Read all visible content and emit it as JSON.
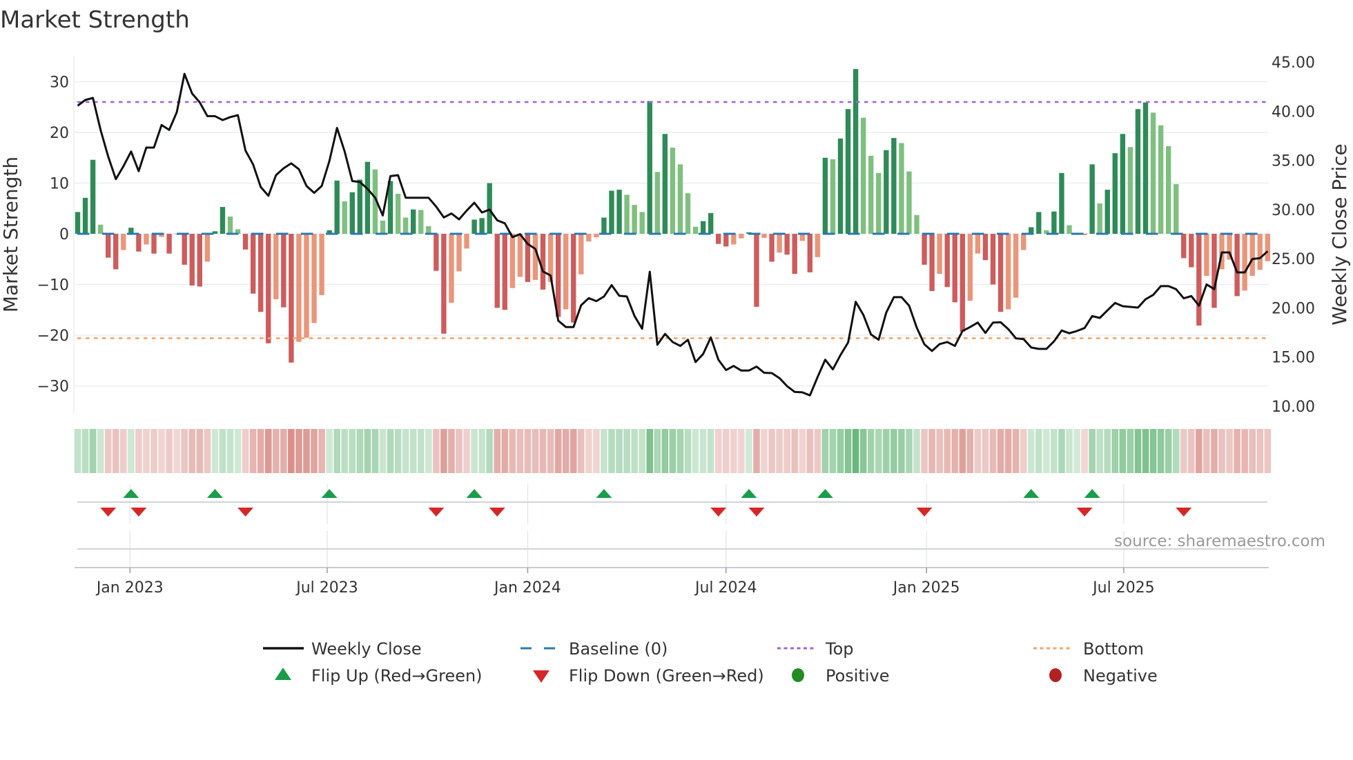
{
  "title": "Market Strength",
  "source": "source: sharemaestro.com",
  "colors": {
    "bar_up_strong": "#2e8b57",
    "bar_up_weak": "#7fbf7f",
    "bar_down_strong": "#cd5c5c",
    "bar_down_weak": "#e9967a",
    "close": "#111111",
    "baseline": "#2a78b0",
    "top": "#a066d8",
    "bottom": "#f2a56a",
    "flip_up": "#1a9e4a",
    "flip_down": "#d62728",
    "positive": "#228b22",
    "negative": "#b22222"
  },
  "legend": {
    "close": "Weekly Close",
    "baseline": "Baseline (0)",
    "top": "Top",
    "bottom": "Bottom",
    "flip_up": "Flip Up (Red→Green)",
    "flip_down": "Flip Down (Green→Red)",
    "positive": "Positive",
    "negative": "Negative"
  },
  "chart_data": {
    "type": "bar",
    "title": "Market Strength",
    "ylabel": "Market Strength",
    "y2label": "Weekly Close Price",
    "ylim": [
      -35.5,
      35.1
    ],
    "y2lim": [
      9.23,
      45.63
    ],
    "yticks": [
      30,
      20,
      10,
      0,
      -10,
      -20,
      -30
    ],
    "ytick_labels": [
      "30",
      "20",
      "10",
      "0",
      "−10",
      "−20",
      "−30"
    ],
    "y2ticks": [
      45,
      40,
      35,
      30,
      25,
      20,
      15,
      10
    ],
    "y2tick_labels": [
      "45.00",
      "40.00",
      "35.00",
      "30.00",
      "25.00",
      "20.00",
      "15.00",
      "10.00"
    ],
    "grid": true,
    "first_week": "2022-11-14",
    "frequency": "weekly",
    "xticks": [
      {
        "label": "Jan 2023",
        "date": "2023-01-01"
      },
      {
        "label": "Jul 2023",
        "date": "2023-07-01"
      },
      {
        "label": "Jan 2024",
        "date": "2024-01-01"
      },
      {
        "label": "Jul 2024",
        "date": "2024-07-01"
      },
      {
        "label": "Jan 2025",
        "date": "2025-01-01"
      },
      {
        "label": "Jul 2025",
        "date": "2025-07-01"
      }
    ],
    "top_level": 26.0,
    "bottom_level": -20.6,
    "baseline": 0,
    "legend_position": "bottom",
    "series": [
      {
        "name": "Market Strength",
        "type": "bar",
        "values": [
          4.3,
          7.1,
          14.6,
          1.8,
          -4.7,
          -7.0,
          -3.2,
          1.2,
          -3.5,
          -2.1,
          -3.9,
          -0.6,
          -3.9,
          -0.1,
          -6.1,
          -10.2,
          -10.4,
          -5.5,
          0.5,
          5.3,
          3.4,
          0.9,
          -3.1,
          -11.8,
          -15.4,
          -21.6,
          -12.9,
          -14.5,
          -25.4,
          -21.3,
          -20.5,
          -17.6,
          -12.1,
          0.7,
          10.5,
          6.4,
          8.2,
          10.7,
          14.2,
          12.7,
          2.6,
          10.4,
          7.9,
          3.2,
          4.8,
          4.7,
          1.5,
          -7.3,
          -19.7,
          -13.6,
          -7.4,
          -2.9,
          2.8,
          3.1,
          10.0,
          -14.6,
          -15.0,
          -10.7,
          -8.5,
          -9.5,
          -9.1,
          -11.0,
          -9.5,
          -16.4,
          -14.9,
          -17.5,
          -8.0,
          -1.5,
          -0.7,
          3.2,
          8.5,
          8.7,
          7.7,
          5.7,
          4.3,
          26.2,
          12.2,
          19.7,
          17.0,
          13.7,
          8.0,
          1.4,
          2.5,
          4.1,
          -2.0,
          -2.5,
          -2.1,
          -0.9,
          0.3,
          -14.4,
          -0.8,
          -5.5,
          -3.7,
          -4.1,
          -7.9,
          -1.4,
          -7.6,
          -4.6,
          15.0,
          14.7,
          18.8,
          24.6,
          32.5,
          22.9,
          15.4,
          12.0,
          16.5,
          18.9,
          17.9,
          12.3,
          3.7,
          -6.1,
          -11.3,
          -7.9,
          -10.5,
          -13.5,
          -19.3,
          -13.2,
          -3.9,
          -5.2,
          -10.0,
          -15.4,
          -14.9,
          -12.6,
          -3.2,
          1.3,
          4.3,
          0.7,
          4.4,
          12.0,
          1.7,
          0.2,
          -0.2,
          13.7,
          6.0,
          8.7,
          15.9,
          19.7,
          17.1,
          24.6,
          25.9,
          23.9,
          21.4,
          17.3,
          9.8,
          -4.8,
          -6.6,
          -18.1,
          -8.3,
          -14.6,
          -7.0,
          -5.1,
          -12.3,
          -11.2,
          -8.3,
          -7.1,
          -5.4
        ]
      },
      {
        "name": "Weekly Close",
        "type": "line",
        "axis": "right",
        "values": [
          40.56,
          41.14,
          41.35,
          38.1,
          35.4,
          33.1,
          34.4,
          35.9,
          33.9,
          36.3,
          36.3,
          38.6,
          38.1,
          39.9,
          43.8,
          41.8,
          40.9,
          39.5,
          39.5,
          39.1,
          39.4,
          39.6,
          36.0,
          34.6,
          32.3,
          31.4,
          33.5,
          34.2,
          34.7,
          34.1,
          32.4,
          31.7,
          32.4,
          34.95,
          38.3,
          35.9,
          32.9,
          32.8,
          32.1,
          31.2,
          29.4,
          33.4,
          33.5,
          31.2,
          31.2,
          31.2,
          31.2,
          30.3,
          29.2,
          29.6,
          29.0,
          29.9,
          30.7,
          29.7,
          30.0,
          28.9,
          28.6,
          27.2,
          27.5,
          26.5,
          26.0,
          23.7,
          23.3,
          18.7,
          18.05,
          18.05,
          20.27,
          20.99,
          20.69,
          21.16,
          22.32,
          21.23,
          21.16,
          19.17,
          17.88,
          23.68,
          16.25,
          17.35,
          16.53,
          16.13,
          16.76,
          14.49,
          15.31,
          17.0,
          14.73,
          13.68,
          14.1,
          13.63,
          13.63,
          14.03,
          13.4,
          13.37,
          12.86,
          12.04,
          11.45,
          11.41,
          11.1,
          12.97,
          14.73,
          13.75,
          15.2,
          16.48,
          20.62,
          19.29,
          17.3,
          16.76,
          19.52,
          21.09,
          21.09,
          20.22,
          18.0,
          16.29,
          15.62,
          16.32,
          16.53,
          16.13,
          17.65,
          18.05,
          18.51,
          17.46,
          18.51,
          18.54,
          17.84,
          16.9,
          16.83,
          15.97,
          15.83,
          15.83,
          16.6,
          17.7,
          17.42,
          17.65,
          17.95,
          19.17,
          18.98,
          19.75,
          20.5,
          20.17,
          20.1,
          20.03,
          20.88,
          21.32,
          22.21,
          22.21,
          21.9,
          20.97,
          21.2,
          20.22,
          22.39,
          21.9,
          25.64,
          25.64,
          23.61,
          23.61,
          24.97,
          25.06,
          25.76
        ]
      }
    ]
  }
}
